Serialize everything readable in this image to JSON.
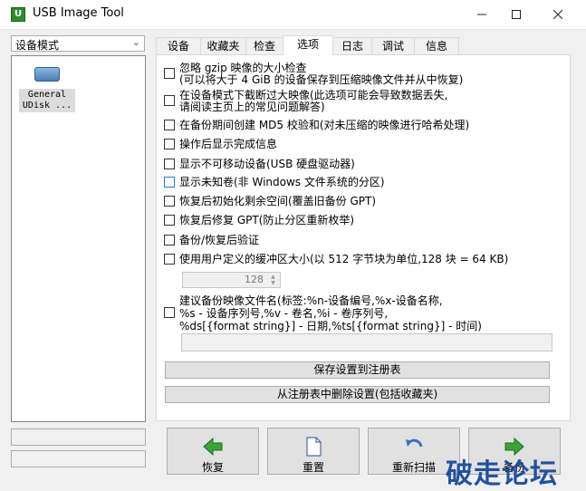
{
  "window": {
    "title": "USB Image Tool",
    "app_icon_letter": "U"
  },
  "left": {
    "mode_value": "设备模式",
    "device": {
      "label_line1": "General",
      "label_line2": "UDisk ..."
    }
  },
  "tabs": [
    {
      "label": "设备"
    },
    {
      "label": "收藏夹"
    },
    {
      "label": "检查"
    },
    {
      "label": "选项"
    },
    {
      "label": "日志"
    },
    {
      "label": "调试"
    },
    {
      "label": "信息"
    }
  ],
  "options": {
    "opt1_line1": "忽略 gzip 映像的大小检查",
    "opt1_line2": "(可以将大于 4 GiB 的设备保存到压缩映像文件并从中恢复)",
    "opt2_line1": "在设备模式下截断过大映像(此选项可能会导致数据丢失,",
    "opt2_line2": "请阅读主页上的常见问题解答)",
    "opt3": "在备份期间创建 MD5 校验和(对未压缩的映像进行哈希处理)",
    "opt4": "操作后显示完成信息",
    "opt5": "显示不可移动设备(USB 硬盘驱动器)",
    "opt6": "显示未知卷(非 Windows 文件系统的分区)",
    "opt7": "恢复后初始化剩余空间(覆盖旧备份 GPT)",
    "opt8": "恢复后修复 GPT(防止分区重新枚举)",
    "opt9": "备份/恢复后验证",
    "opt10": "使用用户定义的缓冲区大小(以 512 字节块为单位,128 块 = 64 KB)",
    "buffer_value": "128",
    "opt11_line1": "建议备份映像文件名(标签:%n-设备编号,%x-设备名称,",
    "opt11_line2": "%s - 设备序列号,%v - 卷名,%i - 卷序列号,",
    "opt11_line3": "%ds[{format string}] - 日期,%ts[{format string}] - 时间)",
    "filename_value": ""
  },
  "buttons": {
    "save_registry": "保存设置到注册表",
    "delete_registry": "从注册表中删除设置(包括收藏夹)",
    "restore": "恢复",
    "reset": "重置",
    "rescan": "重新扫描",
    "backup": "备份"
  },
  "watermark": "破走论坛",
  "colors": {
    "accent_blue": "#2b79d0",
    "arrow_green": "#3aa33a",
    "watermark": "#1a4a9a"
  },
  "icons": {
    "restore": "green-left-arrow",
    "reset": "document-icon",
    "rescan": "refresh-arrow",
    "backup": "green-right-arrow"
  }
}
